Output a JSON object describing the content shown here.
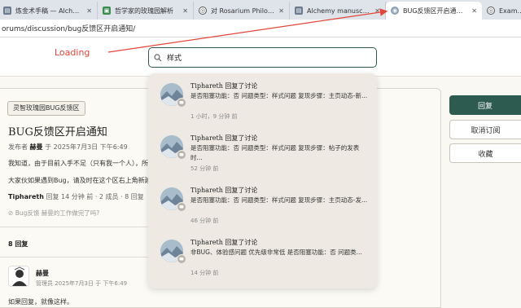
{
  "browser": {
    "tabs": [
      {
        "title": "炼金术手稿 — Alchemy",
        "icon": "doc-icon",
        "active": false
      },
      {
        "title": "哲学家的玫瑰园解析",
        "icon": "book-icon",
        "active": false
      },
      {
        "title": "对 Rosarium Philosopho",
        "icon": "globe-icon",
        "active": false
      },
      {
        "title": "Alchemy manuscript",
        "icon": "doc-icon",
        "active": false
      },
      {
        "title": "BUG反馈区开启通知 - 灵",
        "icon": "site-icon",
        "active": true
      },
      {
        "title": "Example D",
        "icon": "globe-icon",
        "active": false
      }
    ],
    "url": "orums/discussion/bug反馈区开启通知/"
  },
  "annotation": {
    "label": "Loading",
    "color": "#e0473a"
  },
  "search": {
    "value": "样式"
  },
  "topic": {
    "category": "灵智玫瑰园BUG反馈区",
    "title": "BUG反馈区开启通知",
    "meta_prefix": "发布者",
    "author": "赫曼",
    "meta_suffix": "于 2025年7月3日 下午6:49",
    "body_line1": "我知道，由于目前入手不足（只有我一个人），所",
    "body_line2": "大家伙如果遇到Bug，请及时在这个区右上角新建",
    "last_author": "Tiphareth",
    "last_info": "回复 14 分钟 前 · 2 成员 · 8 回复",
    "tags": "Bug反馈  赫曼的工作做完了吗?"
  },
  "replies": {
    "count_label": "8 回复",
    "first": {
      "author": "赫曼",
      "meta": "管理员  2025年7月3日 于 下午6:49",
      "body": "如果回复，就像这样。"
    }
  },
  "sidebar": {
    "reply_label": "回复",
    "unsubscribe_label": "取消订阅",
    "favorite_label": "收藏"
  },
  "results": [
    {
      "title": "Tiphareth 回复了讨论",
      "snippet": "是否阻塞功能：否 问题类型：样式问题 复现步骤：主页动态-新...",
      "time": "1 小时，9 分钟 前"
    },
    {
      "title": "Tiphareth 回复了讨论",
      "snippet": "是否阻塞功能：否 问题类型：样式问题 复现步骤：帖子的发表时...",
      "time": "52 分钟 前"
    },
    {
      "title": "Tiphareth 回复了讨论",
      "snippet": "是否阻塞功能：否 问题类型：样式问题 复现步骤：主页动态-发...",
      "time": "46 分钟 前"
    },
    {
      "title": "Tiphareth 回复了讨论",
      "snippet": "非BUG、体验感问题 优先级非常低 是否阻塞功能：否 问题类...",
      "time": "14 分钟 前"
    }
  ],
  "colors": {
    "brand": "#2e5b50",
    "annotation": "#e0473a"
  }
}
